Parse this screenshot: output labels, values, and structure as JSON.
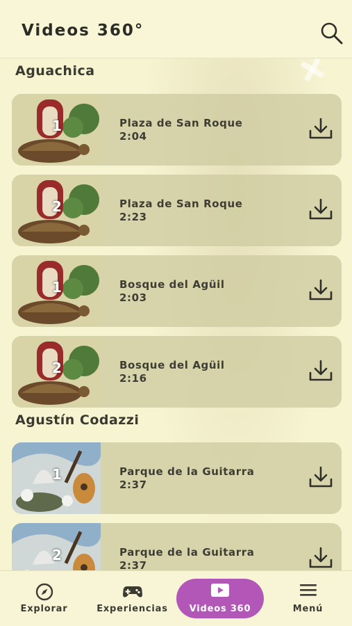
{
  "header": {
    "title": "Videos 360°",
    "search_icon": "search-icon"
  },
  "sections": [
    {
      "title": "Aguachica",
      "videos": [
        {
          "number": "1",
          "title": "Plaza de San Roque",
          "duration": "2:04"
        },
        {
          "number": "2",
          "title": "Plaza de San Roque",
          "duration": "2:23"
        },
        {
          "number": "1",
          "title": "Bosque del Agüil",
          "duration": "2:03"
        },
        {
          "number": "2",
          "title": "Bosque del Agüil",
          "duration": "2:16"
        }
      ]
    },
    {
      "title": "Agustín Codazzi",
      "videos": [
        {
          "number": "1",
          "title": "Parque de la Guitarra",
          "duration": "2:37"
        },
        {
          "number": "2",
          "title": "Parque de la Guitarra",
          "duration": "2:37"
        }
      ]
    }
  ],
  "bottom_nav": [
    {
      "label": "Explorar",
      "icon": "compass-icon",
      "active": false
    },
    {
      "label": "Experiencias",
      "icon": "gamepad-icon",
      "active": false
    },
    {
      "label": "Videos 360",
      "icon": "play-icon",
      "active": true
    },
    {
      "label": "Menú",
      "icon": "hamburger-menu-icon",
      "active": false
    }
  ],
  "colors": {
    "background": "#f7f4d2",
    "card": "#cecba0",
    "active_tab": "#b257b8",
    "text": "#3e3d33"
  }
}
